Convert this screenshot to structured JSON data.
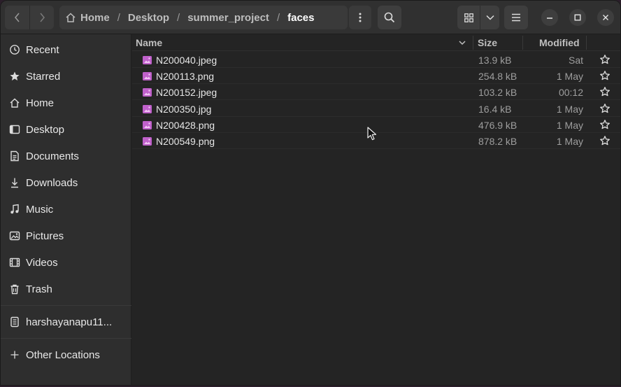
{
  "breadcrumb": [
    "Home",
    "Desktop",
    "summer_project",
    "faces"
  ],
  "sidebar": {
    "items": [
      {
        "label": "Recent",
        "icon": "clock-icon"
      },
      {
        "label": "Starred",
        "icon": "star-icon"
      },
      {
        "label": "Home",
        "icon": "home-icon"
      },
      {
        "label": "Desktop",
        "icon": "desktop-icon"
      },
      {
        "label": "Documents",
        "icon": "document-icon"
      },
      {
        "label": "Downloads",
        "icon": "download-icon"
      },
      {
        "label": "Music",
        "icon": "music-icon"
      },
      {
        "label": "Pictures",
        "icon": "picture-icon"
      },
      {
        "label": "Videos",
        "icon": "video-icon"
      },
      {
        "label": "Trash",
        "icon": "trash-icon"
      }
    ],
    "drive": {
      "label": "harshayanapu11...",
      "icon": "drive-icon"
    },
    "other": {
      "label": "Other Locations",
      "icon": "plus-icon"
    }
  },
  "columns": {
    "name": "Name",
    "size": "Size",
    "modified": "Modified"
  },
  "files": [
    {
      "name": "N200040.jpeg",
      "size": "13.9 kB",
      "modified": "Sat"
    },
    {
      "name": "N200113.png",
      "size": "254.8 kB",
      "modified": "1 May"
    },
    {
      "name": "N200152.jpeg",
      "size": "103.2 kB",
      "modified": "00:12"
    },
    {
      "name": "N200350.jpg",
      "size": "16.4 kB",
      "modified": "1 May"
    },
    {
      "name": "N200428.png",
      "size": "476.9 kB",
      "modified": "1 May"
    },
    {
      "name": "N200549.png",
      "size": "878.2 kB",
      "modified": "1 May"
    }
  ],
  "colors": {
    "accent_file_icon": "#c061cb",
    "window_bg": "#242424",
    "sidebar_bg": "#2e2e2e"
  }
}
